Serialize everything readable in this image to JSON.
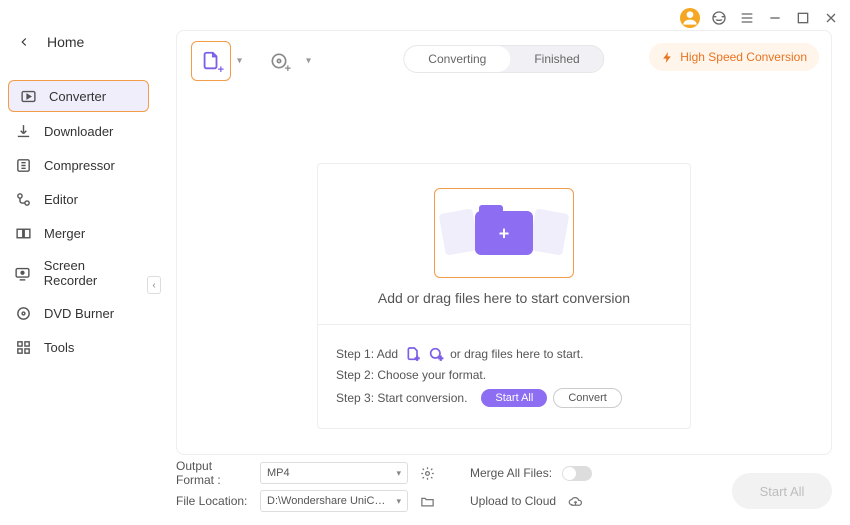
{
  "window": {
    "back_label": "Home"
  },
  "sidebar": {
    "items": [
      {
        "label": "Converter"
      },
      {
        "label": "Downloader"
      },
      {
        "label": "Compressor"
      },
      {
        "label": "Editor"
      },
      {
        "label": "Merger"
      },
      {
        "label": "Screen Recorder"
      },
      {
        "label": "DVD Burner"
      },
      {
        "label": "Tools"
      }
    ]
  },
  "toolbar": {
    "tabs": {
      "converting": "Converting",
      "finished": "Finished"
    },
    "hispeed": "High Speed Conversion"
  },
  "drop": {
    "message": "Add or drag files here to start conversion",
    "step1_prefix": "Step 1: Add",
    "step1_suffix": "or drag files here to start.",
    "step2": "Step 2: Choose your format.",
    "step3": "Step 3: Start conversion.",
    "start_all": "Start All",
    "convert": "Convert"
  },
  "footer": {
    "output_format_label": "Output Format :",
    "output_format_value": "MP4",
    "file_location_label": "File Location:",
    "file_location_value": "D:\\Wondershare UniConverter 1",
    "merge_label": "Merge All Files:",
    "upload_label": "Upload to Cloud",
    "start_all": "Start All"
  }
}
